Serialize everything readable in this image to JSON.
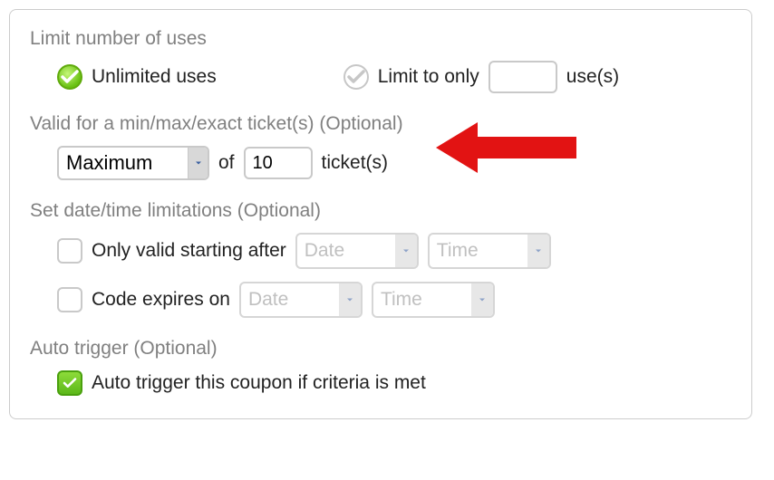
{
  "limitUses": {
    "title": "Limit number of uses",
    "unlimitedLabel": "Unlimited uses",
    "limitToLabel": "Limit to only",
    "limitToSuffix": "use(s)",
    "limitToValue": ""
  },
  "ticketRange": {
    "title": "Valid for a min/max/exact ticket(s) (Optional)",
    "mode": "Maximum",
    "of": "of",
    "count": "10",
    "suffix": "ticket(s)"
  },
  "dateTime": {
    "title": "Set date/time limitations (Optional)",
    "startLabel": "Only valid starting after",
    "expireLabel": "Code expires on",
    "datePlaceholder": "Date",
    "timePlaceholder": "Time"
  },
  "autoTrigger": {
    "title": "Auto trigger (Optional)",
    "label": "Auto trigger this coupon if criteria is met"
  }
}
